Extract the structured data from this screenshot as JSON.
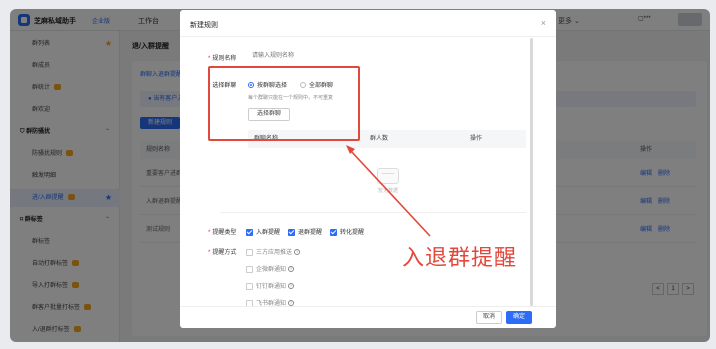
{
  "topbar": {
    "brand": "芝麻私域助手",
    "brand_sub": "企业版",
    "nav_item": "工作台",
    "more": "更多",
    "user": "▢***"
  },
  "sidebar": {
    "items": [
      {
        "label": "群列表",
        "starred": true
      },
      {
        "label": "群成员"
      },
      {
        "label": "群统计",
        "badge": true
      },
      {
        "label": "群欢迎"
      }
    ],
    "group1": "群防骚扰",
    "group1_items": [
      {
        "label": "防骚扰规则",
        "badge": true
      },
      {
        "label": "触发明细"
      },
      {
        "label": "进/入群提醒",
        "badge": true,
        "active": true,
        "starred": true
      }
    ],
    "group2": "群标签",
    "group2_items": [
      {
        "label": "群标签"
      },
      {
        "label": "自动打群标签",
        "badge": true
      },
      {
        "label": "导入打群标签",
        "badge": true
      },
      {
        "label": "群客户批量打标签",
        "badge": true
      },
      {
        "label": "入/退群打标签",
        "badge": true
      }
    ]
  },
  "main": {
    "page_title": "退/入群提醒",
    "tab": "群聊入退群提醒",
    "info": "● 当有客户入",
    "new_button": "新建规则",
    "col_rule_name": "规则名称",
    "col_ops": "操作",
    "rows": [
      {
        "name": "重要客户进群",
        "edit": "编辑",
        "delete": "删除"
      },
      {
        "name": "入群退群提醒",
        "edit": "编辑",
        "delete": "删除"
      },
      {
        "name": "测试规则",
        "edit": "编辑",
        "delete": "删除"
      }
    ],
    "pager": [
      "<",
      "1",
      ">"
    ]
  },
  "modal": {
    "title": "新建规则",
    "close": "×",
    "rule_name_label": "规则名称",
    "rule_name_placeholder": "请输入规则名称",
    "select_group_label": "选择群聊",
    "radio_by_group": "按群聊选择",
    "radio_all": "全部群聊",
    "hint": "每个群聊只能在一个规则中，不可重复",
    "select_button": "选择群聊",
    "table_cols": [
      "群聊名称",
      "群人数",
      "操作"
    ],
    "empty_text": "暂无数据",
    "remind_type_label": "提醒类型",
    "remind_types": [
      {
        "label": "入群提醒",
        "checked": true
      },
      {
        "label": "退群提醒",
        "checked": true
      },
      {
        "label": "转化提醒",
        "checked": true
      }
    ],
    "remind_way_label": "提醒方式",
    "remind_ways": [
      {
        "label": "三方应用推送",
        "help": true
      },
      {
        "label": "企微群通知",
        "help": true
      },
      {
        "label": "钉钉群通知",
        "help": true
      },
      {
        "label": "飞书群通知",
        "help": true
      }
    ],
    "cancel": "取消",
    "ok": "确定"
  },
  "annotation": {
    "text": "入退群提醒",
    "color": "#e2483b"
  },
  "colors": {
    "accent": "#2d6cf6",
    "annotation": "#e2483b",
    "warning": "#f5a623"
  }
}
